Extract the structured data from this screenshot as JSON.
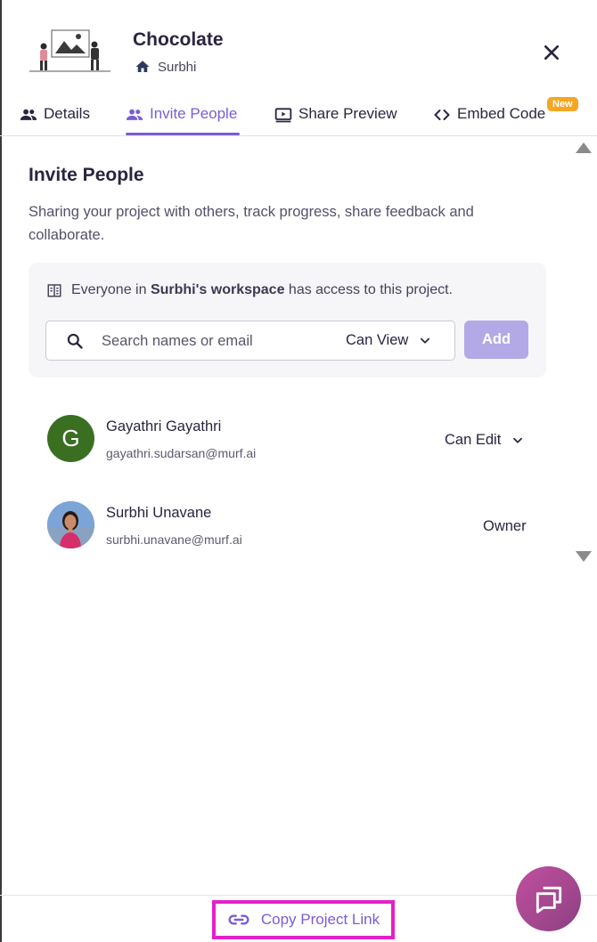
{
  "header": {
    "project_title": "Chocolate",
    "workspace_name": "Surbhi",
    "icons": {
      "workspace": "home-icon",
      "close": "close-icon"
    }
  },
  "tabs": [
    {
      "label": "Details",
      "icon": "people-icon",
      "active": false
    },
    {
      "label": "Invite People",
      "icon": "people-icon",
      "active": true
    },
    {
      "label": "Share Preview",
      "icon": "play-screen-icon",
      "active": false
    },
    {
      "label": "Embed Code",
      "icon": "code-icon",
      "active": false,
      "badge": "New"
    }
  ],
  "invite": {
    "title": "Invite People",
    "description": "Sharing your project with others, track progress, share feedback and collaborate.",
    "access": {
      "prefix": "Everyone in ",
      "workspace": "Surbhi's workspace",
      "suffix": " has access to this project.",
      "icon": "building-icon"
    },
    "search": {
      "placeholder": "Search names or email",
      "value": "",
      "icon": "search-icon"
    },
    "permission": {
      "selected": "Can View"
    },
    "add_label": "Add"
  },
  "members": [
    {
      "name": "Gayathri Gayathri",
      "email": "gayathri.sudarsan@murf.ai",
      "role": "Can Edit",
      "avatar_letter": "G",
      "role_editable": true
    },
    {
      "name": "Surbhi Unavane",
      "email": "surbhi.unavane@murf.ai",
      "role": "Owner",
      "avatar_letter": "",
      "role_editable": false
    }
  ],
  "footer": {
    "copy_link_label": "Copy Project Link",
    "icon": "link-icon"
  },
  "chat": {
    "icon": "chat-icon"
  },
  "colors": {
    "accent": "#7b5cd6",
    "add_button": "#b3a9e6",
    "badge": "#f5a623",
    "highlight": "#e51fc9",
    "avatar_g": "#3a6f22"
  }
}
